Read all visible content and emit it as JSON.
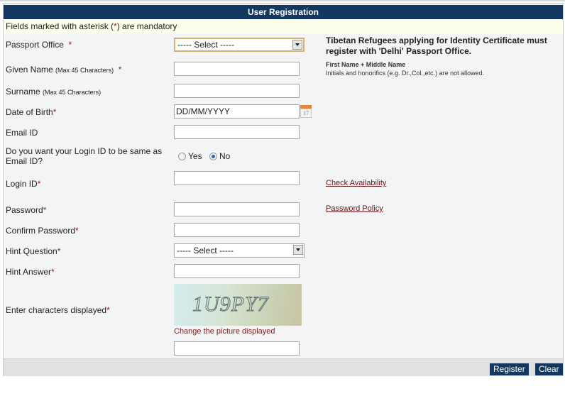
{
  "header": {
    "title": "User Registration"
  },
  "notice": {
    "prefix": "Fields marked with asterisk (",
    "asterisk": "*",
    "suffix": ") are mandatory"
  },
  "form": {
    "passport_office": {
      "label": "Passport Office",
      "req": "*",
      "value": "----- Select -----"
    },
    "given_name": {
      "label": "Given Name",
      "hint": "(Max 45 Characters)",
      "req": "*",
      "value": ""
    },
    "surname": {
      "label": "Surname",
      "hint": "(Max 45 Characters)",
      "value": ""
    },
    "dob": {
      "label": "Date of Birth",
      "req": "*",
      "placeholder": "DD/MM/YYYY",
      "calendar_day": "17"
    },
    "email": {
      "label": "Email ID",
      "value": ""
    },
    "login_same": {
      "label": "Do you want your Login ID to be same as Email ID?",
      "options": [
        "Yes",
        "No"
      ],
      "selected": "No"
    },
    "login_id": {
      "label": "Login ID",
      "req": "*",
      "value": ""
    },
    "password": {
      "label": "Password",
      "req": "*",
      "value": ""
    },
    "confirm_password": {
      "label": "Confirm Password",
      "req": "*",
      "value": ""
    },
    "hint_question": {
      "label": "Hint Question",
      "req": "*",
      "value": "----- Select -----"
    },
    "hint_answer": {
      "label": "Hint Answer",
      "req": "*",
      "value": ""
    },
    "captcha": {
      "label": "Enter characters displayed",
      "req": "*",
      "text": "1U9PY7",
      "change_link": "Change the picture displayed",
      "value": ""
    }
  },
  "side": {
    "tibetan_note": "Tibetan Refugees applying for Identity Certificate must register with 'Delhi' Passport Office.",
    "name_title": "First Name + Middle Name",
    "name_note": "Initials and honorifics (e.g. Dr.,Col.,etc.) are not allowed.",
    "check_availability": "Check Availability",
    "password_policy": "Password Policy"
  },
  "footer": {
    "register": "Register",
    "clear": "Clear"
  },
  "colors": {
    "header_bg": "#13375f",
    "required": "#8b1a1a",
    "notice_bg": "#fdfdec",
    "form_bg": "#f3f4f6"
  }
}
